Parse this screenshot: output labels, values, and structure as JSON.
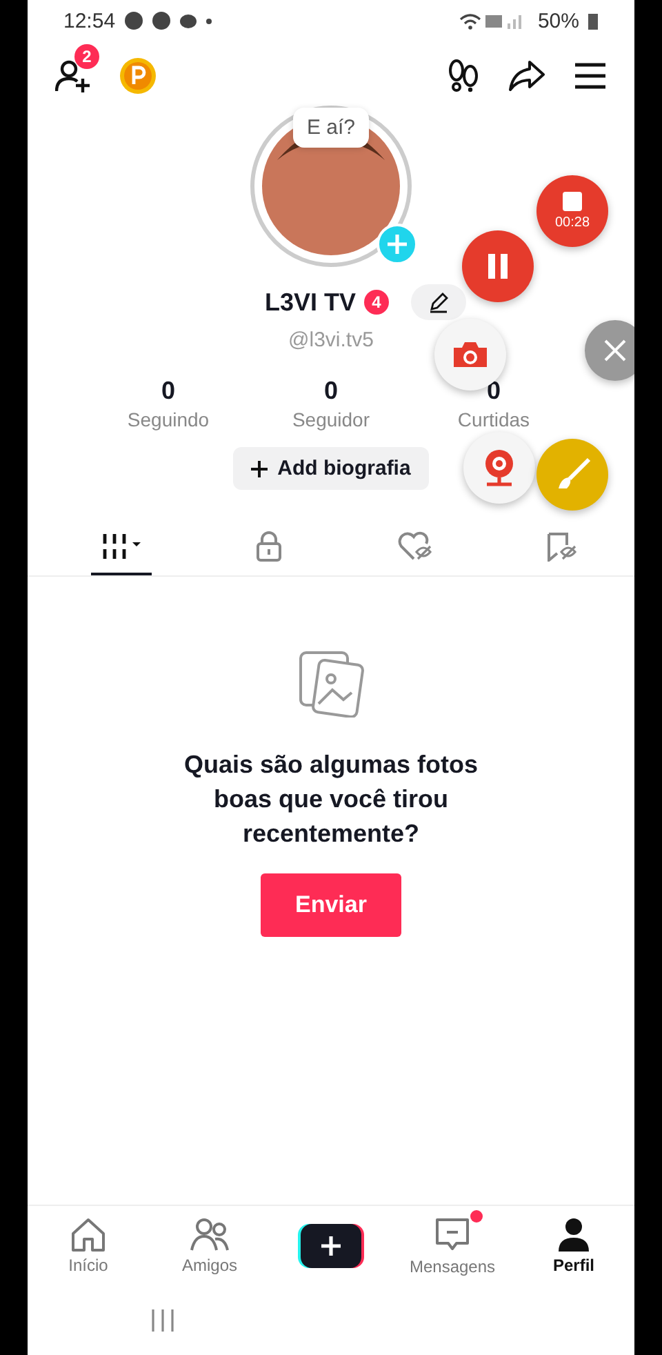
{
  "status_bar": {
    "time": "12:54",
    "battery": "50%"
  },
  "top_bar": {
    "friend_requests": "2",
    "greeting": "E aí?"
  },
  "profile": {
    "name": "L3VI TV",
    "badge": "4",
    "handle": "@l3vi.tv5",
    "stats": [
      {
        "value": "0",
        "label": "Seguindo"
      },
      {
        "value": "0",
        "label": "Seguidor"
      },
      {
        "value": "0",
        "label": "Curtidas"
      }
    ],
    "bio_button": "Add biografia"
  },
  "tabs": [
    {
      "kind": "grid",
      "selected": true
    },
    {
      "kind": "lock",
      "selected": false
    },
    {
      "kind": "liked",
      "selected": false
    },
    {
      "kind": "saved",
      "selected": false
    }
  ],
  "empty_state": {
    "message": "Quais são algumas fotos boas que você tirou recentemente?",
    "button": "Enviar"
  },
  "nav": [
    {
      "kind": "home",
      "label": "Início",
      "selected": false
    },
    {
      "kind": "friends",
      "label": "Amigos",
      "selected": false
    },
    {
      "kind": "create",
      "selected": false
    },
    {
      "kind": "messages",
      "label": "Mensagens",
      "selected": false,
      "unread": true
    },
    {
      "kind": "profile",
      "label": "Perfil",
      "selected": true
    }
  ],
  "recorder": {
    "timer": "00:28"
  }
}
